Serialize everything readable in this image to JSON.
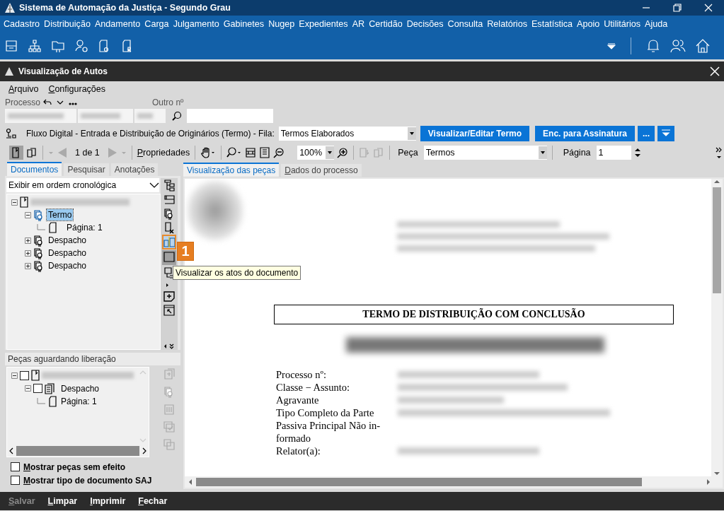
{
  "window": {
    "title": "Sistema de Automação da Justiça - Segundo Grau"
  },
  "menu": [
    "Cadastro",
    "Distribuição",
    "Andamento",
    "Carga",
    "Julgamento",
    "Gabinetes",
    "Nugep",
    "Expedientes",
    "AR",
    "Certidão",
    "Decisões",
    "Consulta",
    "Relatórios",
    "Estatística",
    "Apoio",
    "Utilitários",
    "Ajuda"
  ],
  "dialog": {
    "title": "Visualização de Autos",
    "menu": [
      "Arquivo",
      "Configurações"
    ]
  },
  "process": {
    "label": "Processo",
    "other_label": "Outro nº"
  },
  "flow": {
    "text": "Fluxo Digital - Entrada e Distribuição de Originários (Termo) - Fila:",
    "queue": "Termos Elaborados",
    "buttons": [
      "Visualizar/Editar Termo",
      "Enc. para Assinatura",
      "..."
    ]
  },
  "toolbar": {
    "page_count": "1 de 1",
    "properties": "Propriedades",
    "zoom": "100%",
    "piece_label": "Peça",
    "piece": "Termos",
    "page_label": "Página",
    "page": "1"
  },
  "left_tabs": [
    {
      "label": "Documentos",
      "selected": true
    },
    {
      "label": "Pesquisar",
      "selected": false
    },
    {
      "label": "Anotações",
      "selected": false
    }
  ],
  "order": "Exibir em ordem cronológica",
  "documents": {
    "expanded": true,
    "tree": [
      {
        "label": "Termo",
        "selected": true,
        "expanded": true,
        "children": [
          {
            "label": "Página: 1"
          }
        ]
      },
      {
        "label": "Despacho",
        "selected": false,
        "expanded": false
      },
      {
        "label": "Despacho",
        "selected": false,
        "expanded": false
      },
      {
        "label": "Despacho",
        "selected": false,
        "expanded": false
      }
    ]
  },
  "tooltip": {
    "badge": "1",
    "text": "Visualizar os atos do documento"
  },
  "pending": {
    "title": "Peças aguardando liberação",
    "checked": false,
    "expanded": true,
    "tree": [
      {
        "label": "Despacho",
        "checked": false,
        "expanded": true,
        "children": [
          {
            "label": "Página: 1"
          }
        ]
      }
    ]
  },
  "options": [
    {
      "label": "Mostrar peças sem efeito",
      "checked": false
    },
    {
      "label": "Mostrar tipo de documento SAJ",
      "checked": false
    }
  ],
  "viewer_tabs": [
    {
      "label": "Visualização das peças",
      "selected": true
    },
    {
      "label": "Dados do processo",
      "selected": false
    }
  ],
  "document": {
    "title": "TERMO DE DISTRIBUIÇÃO COM CONCLUSÃO",
    "fields": [
      "Processo nº:",
      "Classe − Assunto:",
      "Agravante",
      "Tipo Completo da Parte Passiva Principal Não in-formado",
      "Relator(a):"
    ]
  },
  "footer": [
    {
      "label": "Salvar",
      "disabled": true
    },
    {
      "label": "Limpar",
      "disabled": false
    },
    {
      "label": "Imprimir",
      "disabled": false
    },
    {
      "label": "Fechar",
      "disabled": false
    }
  ]
}
